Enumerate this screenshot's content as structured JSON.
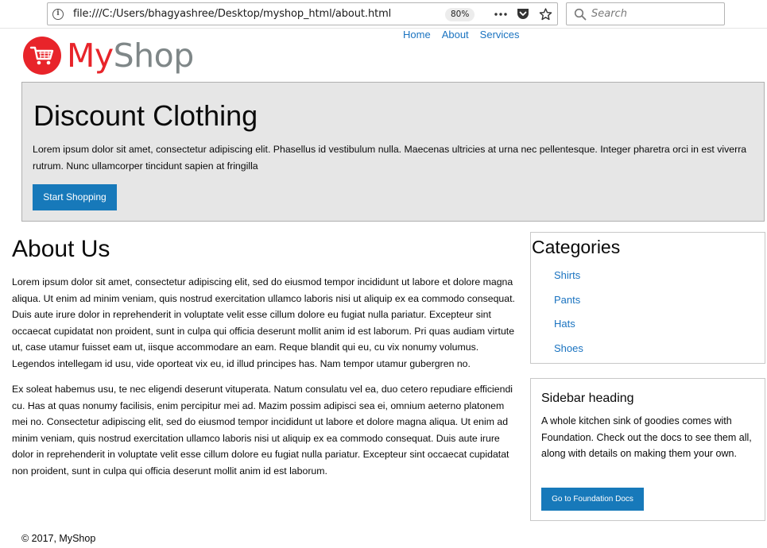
{
  "browser": {
    "url": "file:///C:/Users/bhagyashree/Desktop/myshop_html/about.html",
    "zoom": "80%",
    "search_placeholder": "Search"
  },
  "header": {
    "logo_my": "My",
    "logo_shop": "Shop",
    "nav": [
      "Home",
      "About",
      "Services"
    ]
  },
  "hero": {
    "title": "Discount Clothing",
    "text": "Lorem ipsum dolor sit amet, consectetur adipiscing elit. Phasellus id vestibulum nulla. Maecenas ultricies at urna nec pellentesque. Integer pharetra orci in est viverra rutrum. Nunc ullamcorper tincidunt sapien at fringilla",
    "button": "Start Shopping"
  },
  "main": {
    "title": "About Us",
    "paragraphs": [
      "Lorem ipsum dolor sit amet, consectetur adipiscing elit, sed do eiusmod tempor incididunt ut labore et dolore magna aliqua. Ut enim ad minim veniam, quis nostrud exercitation ullamco laboris nisi ut aliquip ex ea commodo consequat. Duis aute irure dolor in reprehenderit in voluptate velit esse cillum dolore eu fugiat nulla pariatur. Excepteur sint occaecat cupidatat non proident, sunt in culpa qui officia deserunt mollit anim id est laborum. Pri quas audiam virtute ut, case utamur fuisset eam ut, iisque accommodare an eam. Reque blandit qui eu, cu vix nonumy volumus. Legendos intellegam id usu, vide oporteat vix eu, id illud principes has. Nam tempor utamur gubergren no.",
      "Ex soleat habemus usu, te nec eligendi deserunt vituperata. Natum consulatu vel ea, duo cetero repudiare efficiendi cu. Has at quas nonumy facilisis, enim percipitur mei ad. Mazim possim adipisci sea ei, omnium aeterno platonem mei no. Consectetur adipiscing elit, sed do eiusmod tempor incididunt ut labore et dolore magna aliqua. Ut enim ad minim veniam, quis nostrud exercitation ullamco laboris nisi ut aliquip ex ea commodo consequat. Duis aute irure dolor in reprehenderit in voluptate velit esse cillum dolore eu fugiat nulla pariatur. Excepteur sint occaecat cupidatat non proident, sunt in culpa qui officia deserunt mollit anim id est laborum."
    ]
  },
  "sidebar": {
    "categories_title": "Categories",
    "categories": [
      "Shirts",
      "Pants",
      "Hats",
      "Shoes"
    ],
    "heading": "Sidebar heading",
    "text": "A whole kitchen sink of goodies comes with Foundation. Check out the docs to see them all, along with details on making them your own.",
    "button": "Go to Foundation Docs"
  },
  "footer": {
    "text": "© 2017, MyShop"
  },
  "colors": {
    "accent": "#1779ba",
    "link": "#1a73c0",
    "logo_red": "#e8242a",
    "logo_gray": "#7f8788",
    "callout_bg": "#e6e6e6"
  },
  "icons": [
    "info-icon",
    "more-icon",
    "pocket-icon",
    "bookmark-star-icon",
    "search-icon",
    "cart-icon"
  ]
}
